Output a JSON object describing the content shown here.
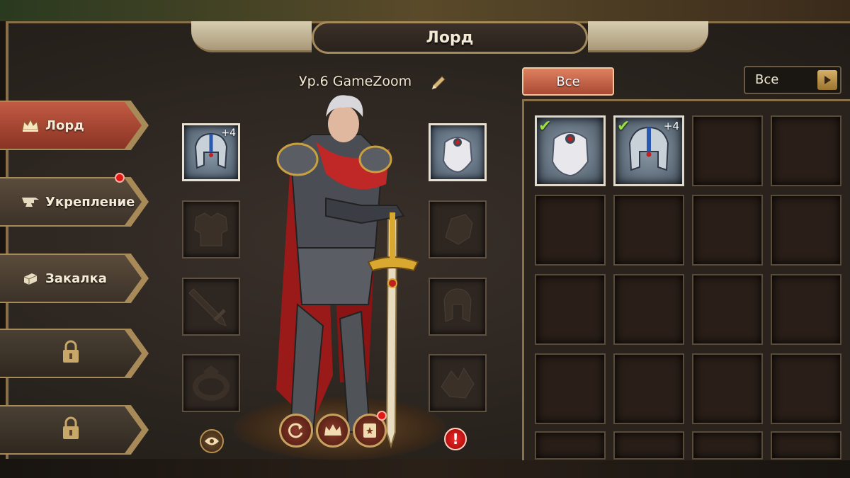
{
  "title": "Лорд",
  "lord_name": "Ур.6 GameZoom",
  "sidebar": {
    "tabs": [
      {
        "label": "Лорд",
        "icon": "crown-icon",
        "state": "active"
      },
      {
        "label": "Укрепление",
        "icon": "anvil-icon",
        "state": "inactive",
        "notification": true
      },
      {
        "label": "Закалка",
        "icon": "whetstone-icon",
        "state": "inactive"
      },
      {
        "label": "",
        "icon": "lock-icon",
        "state": "locked"
      },
      {
        "label": "",
        "icon": "lock-icon",
        "state": "locked"
      }
    ]
  },
  "equipment": {
    "left": [
      {
        "slot": "helmet",
        "filled": true,
        "enhance": "+4"
      },
      {
        "slot": "armor",
        "filled": false
      },
      {
        "slot": "weapon",
        "filled": false
      },
      {
        "slot": "ring",
        "filled": false
      }
    ],
    "right": [
      {
        "slot": "cloak",
        "filled": true
      },
      {
        "slot": "gloves",
        "filled": false
      },
      {
        "slot": "boots",
        "filled": false
      },
      {
        "slot": "accessory",
        "filled": false
      }
    ]
  },
  "action_buttons": [
    {
      "name": "reset-button",
      "icon": "refresh-icon"
    },
    {
      "name": "crown-button",
      "icon": "crown-icon"
    },
    {
      "name": "book-button",
      "icon": "book-icon",
      "notification": true
    }
  ],
  "filter": {
    "button_label": "Все",
    "dropdown_label": "Все"
  },
  "inventory": {
    "columns": 4,
    "items": [
      {
        "item": "cloak",
        "equipped": true,
        "enhance": ""
      },
      {
        "item": "helmet",
        "equipped": true,
        "enhance": "+4"
      }
    ]
  },
  "colors": {
    "accent": "#b8492f",
    "gold": "#a88a58",
    "notification": "#e01818"
  }
}
